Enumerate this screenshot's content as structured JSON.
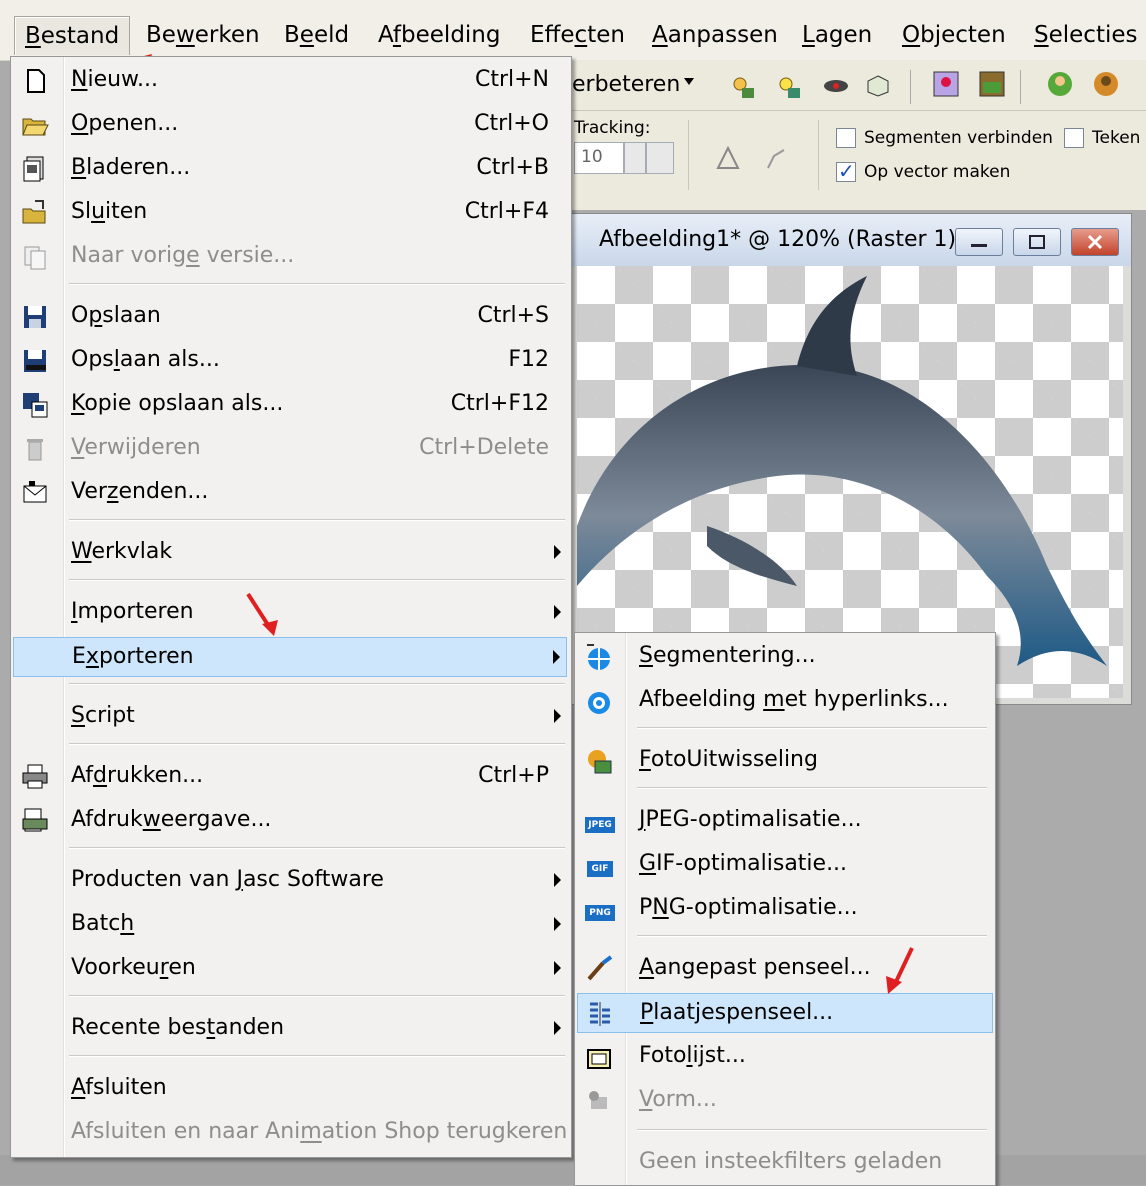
{
  "menubar": {
    "items": [
      {
        "label": "Bestand",
        "hot": "B"
      },
      {
        "label": "Bewerken",
        "hot": "w"
      },
      {
        "label": "Beeld",
        "hot": "e"
      },
      {
        "label": "Afbeelding",
        "hot": "f"
      },
      {
        "label": "Effecten",
        "hot": "c"
      },
      {
        "label": "Aanpassen",
        "hot": "A"
      },
      {
        "label": "Lagen",
        "hot": "L"
      },
      {
        "label": "Objecten",
        "hot": "O"
      },
      {
        "label": "Selecties",
        "hot": "S"
      }
    ]
  },
  "toolbar": {
    "enhance_label": "erbeteren",
    "tracking_label": "Tracking:",
    "tracking_value": "10",
    "segment_label": "Segmenten verbinden",
    "teken_label": "Teken",
    "vector_label": "Op vector maken"
  },
  "image_window": {
    "title": "Afbeelding1* @ 120% (Raster 1)"
  },
  "main_menu": {
    "items": [
      {
        "label": "Nieuw...",
        "shortcut": "Ctrl+N",
        "icon": "new-document-icon"
      },
      {
        "label": "Openen...",
        "shortcut": "Ctrl+O",
        "icon": "open-folder-icon"
      },
      {
        "label": "Bladeren...",
        "shortcut": "Ctrl+B",
        "icon": "browse-icon"
      },
      {
        "label": "Sluiten",
        "shortcut": "Ctrl+F4",
        "icon": "close-folder-icon"
      },
      {
        "label": "Naar vorige versie...",
        "shortcut": "",
        "icon": "revert-icon"
      },
      {
        "label": "Opslaan",
        "shortcut": "Ctrl+S",
        "icon": "save-icon"
      },
      {
        "label": "Opslaan als...",
        "shortcut": "F12",
        "icon": "save-as-icon"
      },
      {
        "label": "Kopie opslaan als...",
        "shortcut": "Ctrl+F12",
        "icon": "save-copy-icon"
      },
      {
        "label": "Verwijderen",
        "shortcut": "Ctrl+Delete",
        "icon": "trash-icon"
      },
      {
        "label": "Verzenden...",
        "shortcut": "",
        "icon": "send-icon"
      },
      {
        "label": "Werkvlak",
        "shortcut": ""
      },
      {
        "label": "Importeren",
        "shortcut": ""
      },
      {
        "label": "Exporteren",
        "shortcut": ""
      },
      {
        "label": "Script",
        "shortcut": ""
      },
      {
        "label": "Afdrukken...",
        "shortcut": "Ctrl+P",
        "icon": "print-icon"
      },
      {
        "label": "Afdrukweergave...",
        "shortcut": "",
        "icon": "print-preview-icon"
      },
      {
        "label": "Producten van Jasc Software",
        "shortcut": ""
      },
      {
        "label": "Batch",
        "shortcut": ""
      },
      {
        "label": "Voorkeuren",
        "shortcut": ""
      },
      {
        "label": "Recente bestanden",
        "shortcut": ""
      },
      {
        "label": "Afsluiten",
        "shortcut": ""
      },
      {
        "label": "Afsluiten en naar Animation Shop terugkeren",
        "shortcut": ""
      }
    ]
  },
  "sub_menu": {
    "items": [
      {
        "label": "Segmentering...",
        "icon": "globe-icon"
      },
      {
        "label": "Afbeelding met hyperlinks...",
        "icon": "hyperlink-target-icon"
      },
      {
        "label": "FotoUitwisseling",
        "icon": "photo-exchange-icon"
      },
      {
        "label": "JPEG-optimalisatie...",
        "icon": "jpeg-icon"
      },
      {
        "label": "GIF-optimalisatie...",
        "icon": "gif-icon"
      },
      {
        "label": "PNG-optimalisatie...",
        "icon": "png-icon"
      },
      {
        "label": "Aangepast penseel...",
        "icon": "brush-icon"
      },
      {
        "label": "Plaatjespenseel...",
        "icon": "picture-tube-icon"
      },
      {
        "label": "Fotolijst...",
        "icon": "picture-frame-icon"
      },
      {
        "label": "Vorm...",
        "icon": "shape-icon"
      },
      {
        "label": "Geen insteekfilters geladen"
      }
    ],
    "badges": {
      "jpeg": "JPEG",
      "gif": "GIF",
      "png": "PNG"
    }
  },
  "colors": {
    "highlight": "#cde6fb",
    "annotation_arrow": "#e02020"
  }
}
